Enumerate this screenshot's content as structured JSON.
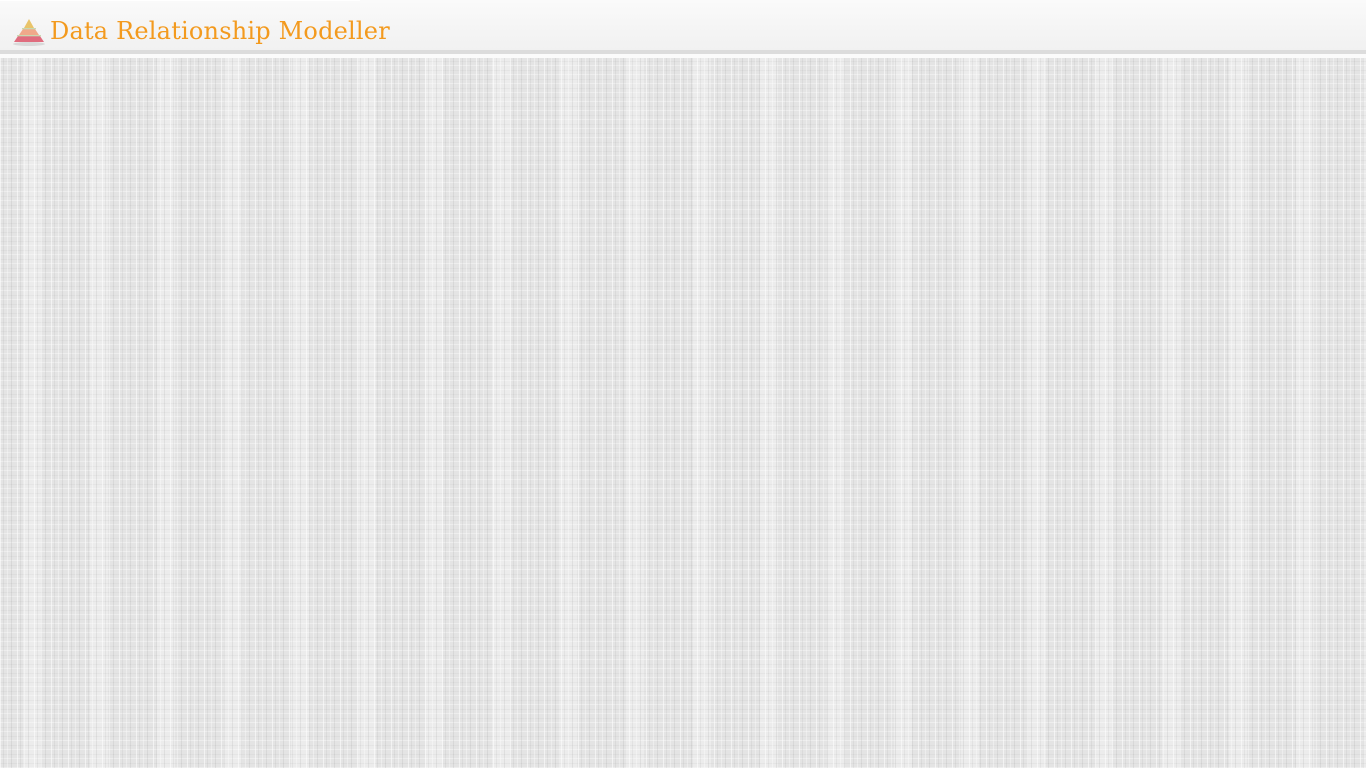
{
  "app": {
    "title": "Data Relationship Modeller",
    "logo_icon": "pyramid-logo-icon"
  },
  "colors": {
    "title": "#f39a1e",
    "logo_top": "#e9c46a",
    "logo_middle": "#f0a98a",
    "logo_bottom": "#e06c7e",
    "background": "#e9e9e9"
  }
}
